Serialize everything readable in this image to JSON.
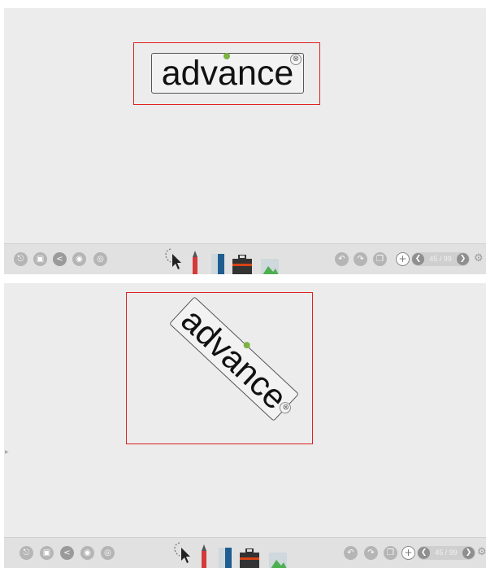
{
  "top_view": {
    "word": "advance",
    "close_glyph": "⊗",
    "page_indicator": "45 / 99"
  },
  "bottom_view": {
    "word": "advance",
    "plus_glyph": "⊕",
    "page_indicator": "45 / 99"
  },
  "toolbar": {
    "left_icons": [
      "exit-icon",
      "save-icon",
      "share-icon",
      "user-add-icon",
      "user-switch-icon"
    ],
    "tools": [
      "lasso-select-icon",
      "pen-icon",
      "eraser-icon",
      "toolbox-icon",
      "image-icon"
    ],
    "right_icons": [
      "undo-icon",
      "redo-icon",
      "copy-page-icon",
      "add-page-icon",
      "prev-page-icon",
      "next-page-icon",
      "settings-icon"
    ],
    "gear_glyph": "⚙",
    "plus_glyph": "+",
    "prev_glyph": "❮",
    "next_glyph": "❯"
  },
  "colors": {
    "canvas": "#ececec",
    "toolbar": "#e1e1e1",
    "selection": "#e02020",
    "handle": "#7cb342"
  }
}
